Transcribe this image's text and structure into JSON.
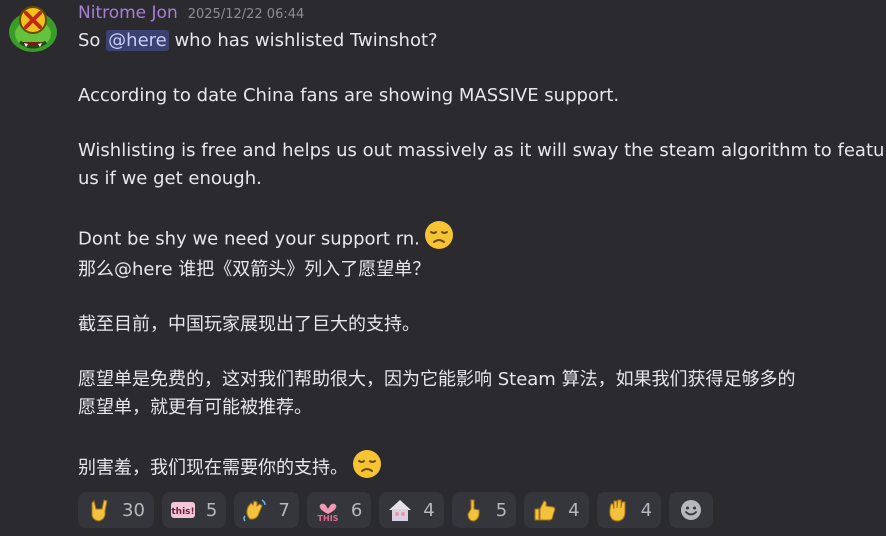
{
  "message": {
    "author": "Nitrome Jon",
    "timestamp": "2025/12/22 06:44",
    "line1_pre": "So ",
    "mention": "@here",
    "line1_post": " who has wishlisted Twinshot?",
    "line2": "According to date China fans are showing MASSIVE support.",
    "line3": "Wishlisting is free and helps us out massively as it will sway the  steam algorithm to feature",
    "line4": "us if  we get enough.",
    "line5": "Dont be shy we need your support rn.",
    "cn_line1": "那么@here 谁把《双箭头》列入了愿望单？",
    "cn_line2": "截至目前，中国玩家展现出了巨大的支持。",
    "cn_line3": "愿望单是免费的，这对我们帮助很大，因为它能影响 Steam 算法，如果我们获得足够多的",
    "cn_line4": "愿望单，就更有可能被推荐。",
    "cn_line5": "别害羞，我们现在需要你的支持。"
  },
  "reactions": [
    {
      "icon": "rock-hand-icon",
      "count": "30"
    },
    {
      "icon": "this-sticker-icon",
      "label": "this!",
      "count": "5"
    },
    {
      "icon": "waving-hand-icon",
      "count": "7"
    },
    {
      "icon": "this-heart-icon",
      "label": "THIS",
      "count": "6"
    },
    {
      "icon": "house-emote-icon",
      "count": "4"
    },
    {
      "icon": "pointing-up-icon",
      "count": "5"
    },
    {
      "icon": "thumbs-up-icon",
      "count": "4"
    },
    {
      "icon": "raised-hand-icon",
      "count": "4"
    }
  ],
  "colors": {
    "background": "#2b2a2f",
    "author": "#a97fd6",
    "mention_bg": "#3c4270",
    "reaction_bg": "#35363c"
  }
}
